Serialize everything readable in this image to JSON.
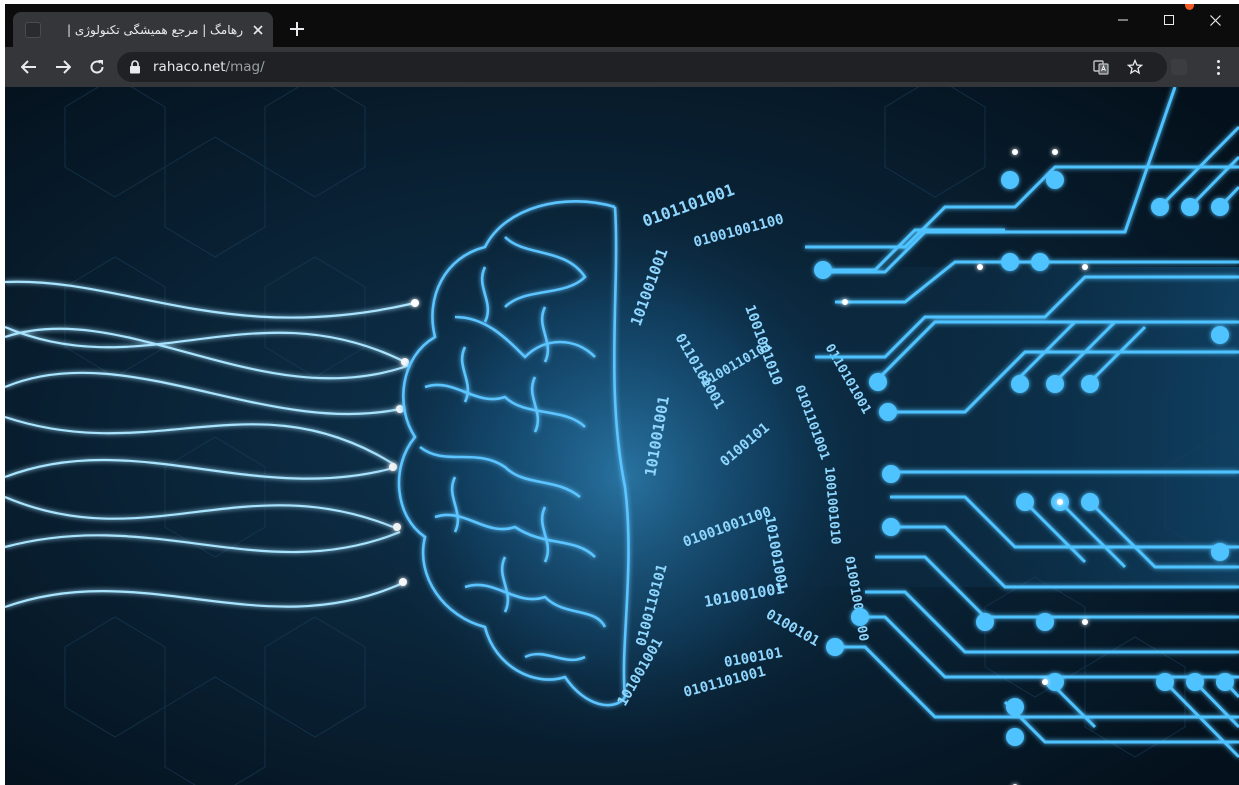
{
  "browser": {
    "tab": {
      "title": "رهامگ | مرجع همیشگی تکنولوژی |",
      "close_icon": "close-icon"
    },
    "new_tab_icon": "plus-icon",
    "window_controls": [
      "minimize-icon",
      "maximize-icon",
      "close-icon"
    ],
    "toolbar": {
      "back_icon": "arrow-left-icon",
      "forward_icon": "arrow-right-icon",
      "reload_icon": "reload-icon",
      "url_host": "rahaco.net",
      "url_path": "/mag/",
      "translate_icon": "translate-icon",
      "bookmark_icon": "star-icon",
      "extension_icon": "extension-icon",
      "menu_icon": "kebab-menu-icon"
    }
  },
  "page": {
    "hero_image": "brain-circuit-binary-illustration",
    "binary_strings": [
      "0101101001",
      "01001001100",
      "101001001",
      "0110101001",
      "1001001010",
      "0100110101",
      "101001001",
      "0100101"
    ]
  },
  "colors": {
    "tabstrip": "#0c0c0d",
    "toolbar": "#35363a",
    "page_background": "#061523",
    "glow": "#4fc3ff",
    "accent_orange": "#f05a23"
  }
}
